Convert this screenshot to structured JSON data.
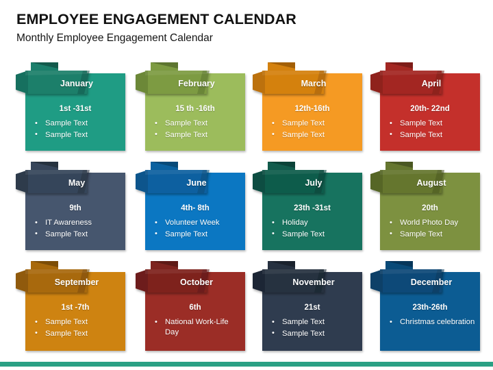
{
  "header": {
    "title": "EMPLOYEE ENGAGEMENT CALENDAR",
    "subtitle": "Monthly Employee Engagement Calendar"
  },
  "footer": {
    "accent_color": "#2aa084"
  },
  "calendar": {
    "columns": 4,
    "rows": 3,
    "months": [
      {
        "name": "January",
        "date": "1st -31st",
        "bullets": [
          "Sample Text",
          "Sample Text"
        ],
        "colors": {
          "body": "#1f9c84",
          "banner": "#1b7f6b",
          "fold": "#135a4c",
          "tail": "#17705f"
        }
      },
      {
        "name": "February",
        "date": "15 th -16th",
        "bullets": [
          "Sample Text",
          "Sample Text"
        ],
        "colors": {
          "body": "#9cbc5c",
          "banner": "#7d9b42",
          "fold": "#5d7530",
          "tail": "#6c8838"
        }
      },
      {
        "name": "March",
        "date": "12th-16th",
        "bullets": [
          "Sample Text",
          "Sample Text"
        ],
        "colors": {
          "body": "#f59a23",
          "banner": "#d4810e",
          "fold": "#a35f05",
          "tail": "#bc7109"
        }
      },
      {
        "name": "April",
        "date": "20th- 22nd",
        "bullets": [
          "Sample Text",
          "Sample Text"
        ],
        "colors": {
          "body": "#c4302b",
          "banner": "#a32722",
          "fold": "#7d1c18",
          "tail": "#8f211d"
        }
      },
      {
        "name": "May",
        "date": "9th",
        "bullets": [
          "IT Awareness",
          "Sample Text"
        ],
        "colors": {
          "body": "#46566e",
          "banner": "#36455a",
          "fold": "#26323f",
          "tail": "#2e3b4c"
        }
      },
      {
        "name": "June",
        "date": "4th- 8th",
        "bullets": [
          "Volunteer Week",
          "Sample Text"
        ],
        "colors": {
          "body": "#0b77c2",
          "banner": "#0961a0",
          "fold": "#064a79",
          "tail": "#07558c"
        }
      },
      {
        "name": "July",
        "date": "23th -31st",
        "bullets": [
          "Holiday",
          "Sample Text"
        ],
        "colors": {
          "body": "#17735f",
          "banner": "#115b4c",
          "fold": "#0b4238",
          "tail": "#0e4e42"
        }
      },
      {
        "name": "August",
        "date": "20th",
        "bullets": [
          "World Photo Day",
          "Sample Text"
        ],
        "colors": {
          "body": "#7d9140",
          "banner": "#65762f",
          "fold": "#4a5722",
          "tail": "#576628"
        }
      },
      {
        "name": "September",
        "date": "1st -7th",
        "bullets": [
          "Sample Text",
          "Sample Text"
        ],
        "colors": {
          "body": "#ce8311",
          "banner": "#a8690b",
          "fold": "#7c4d06",
          "tail": "#905a08"
        }
      },
      {
        "name": "October",
        "date": "6th",
        "bullets": [
          "National Work-Life Day"
        ],
        "colors": {
          "body": "#9b2d26",
          "banner": "#7e241f",
          "fold": "#5e1a16",
          "tail": "#6d1f1a"
        }
      },
      {
        "name": "November",
        "date": "21st",
        "bullets": [
          "Sample Text",
          "Sample Text"
        ],
        "colors": {
          "body": "#2f3c4f",
          "banner": "#263140",
          "fold": "#1a222d",
          "tail": "#1f2835"
        }
      },
      {
        "name": "December",
        "date": "23th-26th",
        "bullets": [
          "Christmas celebration"
        ],
        "colors": {
          "body": "#0c5c93",
          "banner": "#094a78",
          "fold": "#06365a",
          "tail": "#073f68"
        }
      }
    ]
  }
}
